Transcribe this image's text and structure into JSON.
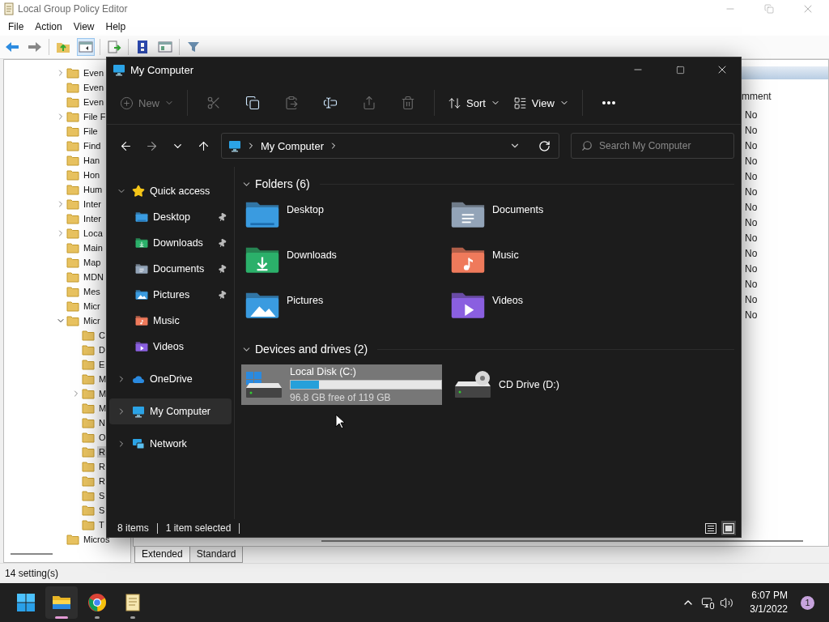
{
  "background_window": {
    "title": "Local Group Policy Editor",
    "menu": [
      "File",
      "Action",
      "View",
      "Help"
    ],
    "tree": [
      {
        "label": "Even",
        "expanded": false,
        "selected": false
      },
      {
        "label": "Even",
        "selected": false
      },
      {
        "label": "Even",
        "selected": false
      },
      {
        "label": "File F",
        "expanded": false,
        "selected": false
      },
      {
        "label": "File",
        "selected": false
      },
      {
        "label": "Find",
        "selected": false
      },
      {
        "label": "Han",
        "selected": false
      },
      {
        "label": "Hon",
        "selected": false
      },
      {
        "label": "Hum",
        "selected": false
      },
      {
        "label": "Inter",
        "expanded": false,
        "selected": false
      },
      {
        "label": "Inter",
        "selected": false
      },
      {
        "label": "Loca",
        "expanded": false,
        "selected": false
      },
      {
        "label": "Main",
        "selected": false
      },
      {
        "label": "Map",
        "selected": false
      },
      {
        "label": "MDN",
        "selected": false
      },
      {
        "label": "Mes",
        "selected": false
      },
      {
        "label": "Micr",
        "selected": false
      },
      {
        "label": "Micr",
        "expanded": true,
        "selected": false,
        "children": [
          {
            "label": "C",
            "selected": false
          },
          {
            "label": "D",
            "selected": false
          },
          {
            "label": "E",
            "selected": false
          },
          {
            "label": "M",
            "selected": false
          },
          {
            "label": "M",
            "expanded": false,
            "selected": false
          },
          {
            "label": "M",
            "selected": false
          },
          {
            "label": "N",
            "selected": false
          },
          {
            "label": "O",
            "selected": false
          },
          {
            "label": "R",
            "selected": true
          },
          {
            "label": "R",
            "selected": false
          },
          {
            "label": "R",
            "selected": false
          },
          {
            "label": "S",
            "selected": false
          },
          {
            "label": "S",
            "selected": false
          },
          {
            "label": "T",
            "selected": false
          }
        ]
      },
      {
        "label": "Micros",
        "selected": false
      }
    ],
    "list": {
      "column_header": "mment",
      "rows": [
        "No",
        "No",
        "No",
        "No",
        "No",
        "No",
        "No",
        "No",
        "No",
        "No",
        "No",
        "No",
        "No",
        "No"
      ]
    },
    "tabs": [
      {
        "label": "Extended",
        "selected": true
      },
      {
        "label": "Standard",
        "selected": false
      }
    ],
    "status": "14 setting(s)"
  },
  "explorer": {
    "title": "My Computer",
    "new": {
      "label": "New",
      "disabled": true
    },
    "tools": [
      {
        "kind": "cut",
        "disabled": true
      },
      {
        "kind": "copy",
        "disabled": false
      },
      {
        "kind": "paste",
        "disabled": true
      },
      {
        "kind": "rename",
        "disabled": false
      },
      {
        "kind": "share",
        "disabled": true
      },
      {
        "kind": "delete",
        "disabled": true
      }
    ],
    "sort": "Sort",
    "view": "View",
    "address": "My Computer",
    "search_placeholder": "Search My Computer",
    "nav": [
      {
        "kind": "star",
        "label": "Quick access",
        "expanded": true,
        "selected": false,
        "children": [
          {
            "kind": "desktop",
            "label": "Desktop",
            "pinned": true,
            "selected": false
          },
          {
            "kind": "downloads",
            "label": "Downloads",
            "pinned": true,
            "selected": false
          },
          {
            "kind": "documents",
            "label": "Documents",
            "pinned": true,
            "selected": false
          },
          {
            "kind": "pictures",
            "label": "Pictures",
            "pinned": true,
            "selected": false
          },
          {
            "kind": "music",
            "label": "Music",
            "pinned": false,
            "selected": false
          },
          {
            "kind": "videos",
            "label": "Videos",
            "pinned": false,
            "selected": false
          }
        ]
      },
      {
        "kind": "cloud",
        "label": "OneDrive",
        "expanded": false,
        "selected": false
      },
      {
        "kind": "computer",
        "label": "My Computer",
        "expanded": false,
        "selected": true
      },
      {
        "kind": "network",
        "label": "Network",
        "expanded": false,
        "selected": false
      }
    ],
    "groups": [
      {
        "title": "Folders (6)",
        "expanded": true,
        "items": [
          {
            "kind": "desktop",
            "label": "Desktop",
            "selected": false
          },
          {
            "kind": "documents",
            "label": "Documents",
            "selected": false
          },
          {
            "kind": "downloads",
            "label": "Downloads",
            "selected": false
          },
          {
            "kind": "music",
            "label": "Music",
            "selected": false
          },
          {
            "kind": "pictures",
            "label": "Pictures",
            "selected": false
          },
          {
            "kind": "videos",
            "label": "Videos",
            "selected": false
          }
        ]
      },
      {
        "title": "Devices and drives (2)",
        "expanded": true,
        "items": [
          {
            "kind": "disk",
            "label": "Local Disk (C:)",
            "level": 0.19,
            "detail": "96.8 GB free of 119 GB",
            "selected": true
          },
          {
            "kind": "cd",
            "label": "CD Drive (D:)",
            "selected": false
          }
        ]
      }
    ],
    "status": [
      "8 items",
      "1 item selected"
    ],
    "views": [
      {
        "kind": "details",
        "selected": false
      },
      {
        "kind": "tiles",
        "selected": true
      }
    ]
  },
  "taskbar": {
    "apps": [
      {
        "kind": "explorer",
        "active": true
      },
      {
        "kind": "browser",
        "active": false
      },
      {
        "kind": "document",
        "active": false
      }
    ],
    "time": "6:07 PM",
    "date": "3/1/2022",
    "badge": "1"
  }
}
